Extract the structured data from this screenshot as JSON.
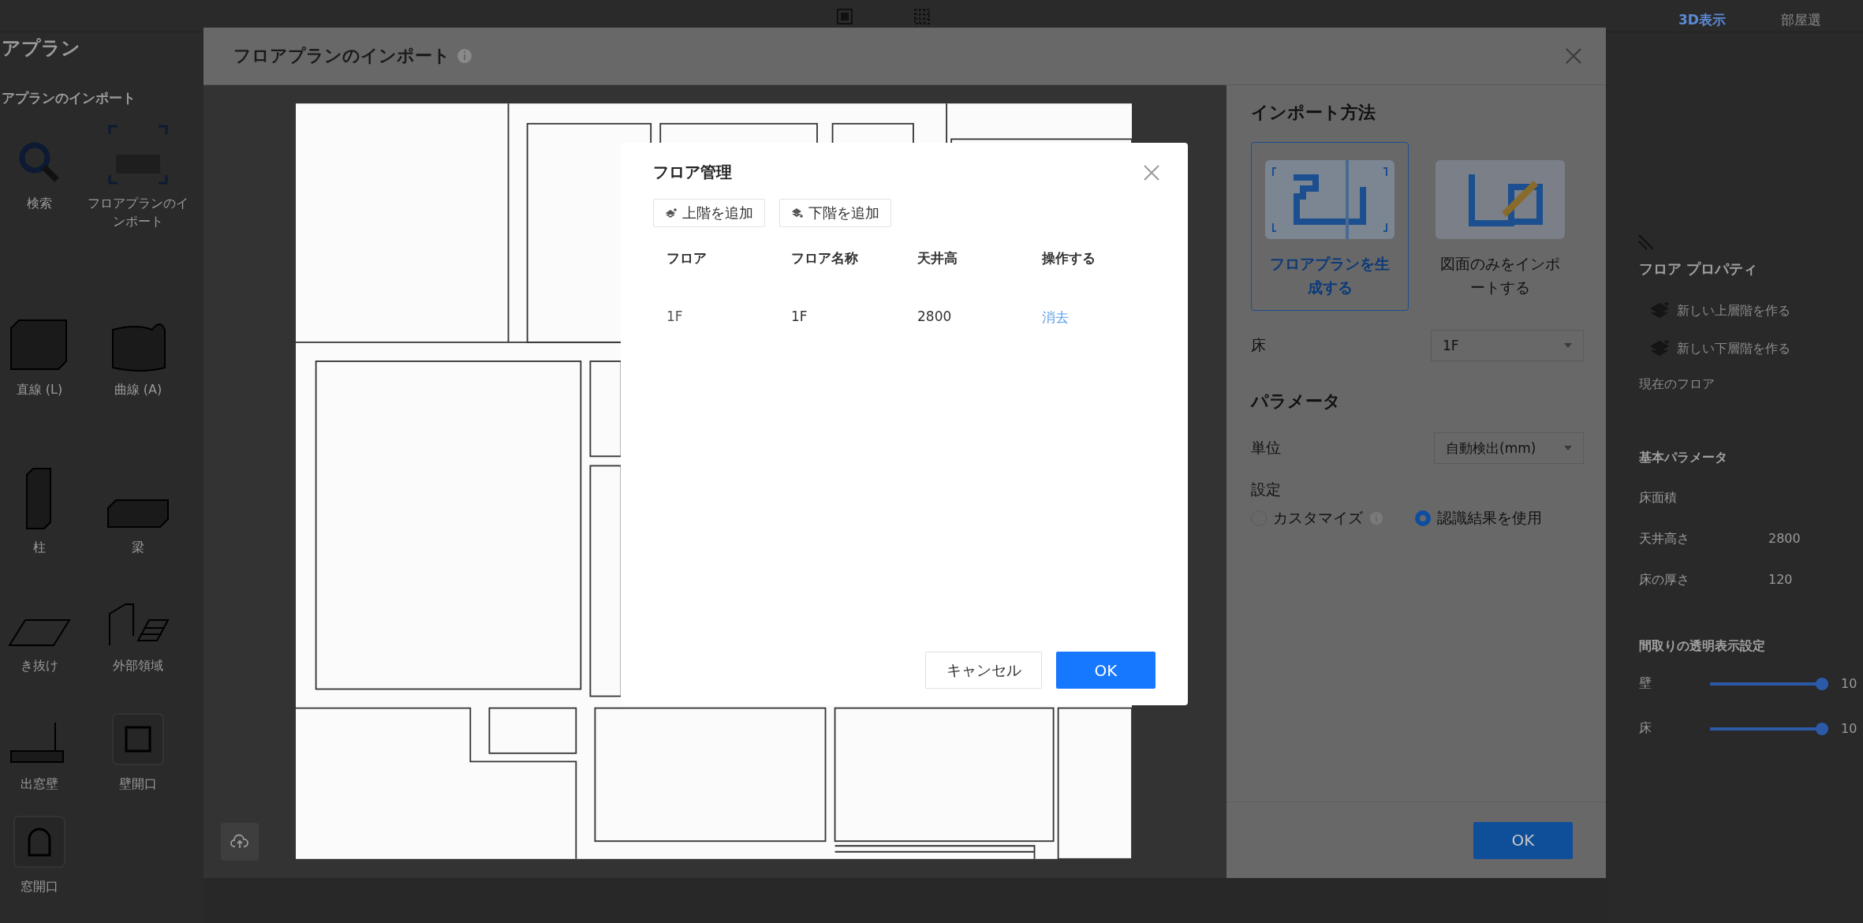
{
  "top_bar": {
    "tabs": [
      {
        "label": "3D表示",
        "selected": true
      },
      {
        "label": "部屋選",
        "selected": false
      }
    ]
  },
  "sidebar": {
    "title": "アプラン",
    "section": "アプランのインポート",
    "tools": [
      {
        "label": "検索"
      },
      {
        "label": "フロアプランのインポート"
      },
      {
        "label": "直線 (L)"
      },
      {
        "label": "曲線 (A)"
      },
      {
        "label": "柱"
      },
      {
        "label": "梁"
      },
      {
        "label": "き抜け"
      },
      {
        "label": "外部領域"
      },
      {
        "label": "出窓壁"
      },
      {
        "label": "壁開口"
      },
      {
        "label": "窓開口"
      }
    ]
  },
  "properties_panel": {
    "title": "フロア プロパティ",
    "actions": [
      "新しい上層階を作る",
      "新しい下層階を作る"
    ],
    "current_floor": "現在のフロア",
    "basic_title": "基本パラメータ",
    "params": [
      {
        "label": "床面積"
      },
      {
        "label": "天井高さ",
        "value": "2800"
      },
      {
        "label": "床の厚さ",
        "value": "120"
      }
    ],
    "transparency_title": "間取りの透明表示設定",
    "sliders": [
      {
        "label": "壁",
        "level": 1,
        "reading": "10"
      },
      {
        "label": "床",
        "level": 1,
        "reading": "10"
      }
    ]
  },
  "import_dialog": {
    "title": "フロアプランのインポート",
    "method_title": "インポート方法",
    "methods": [
      {
        "label": "フロアプランを生成する",
        "selected": true
      },
      {
        "label": "図面のみをインポートする",
        "selected": false
      }
    ],
    "floor": {
      "label": "床",
      "value": "1F"
    },
    "parameters_title": "パラメータ",
    "unit": {
      "label": "単位",
      "value": "自動検出(mm)"
    },
    "setting": {
      "label": "設定",
      "options": [
        {
          "label": "カスタマイズ",
          "selected": false,
          "info": true
        },
        {
          "label": "認識結果を使用",
          "selected": true,
          "info": false
        }
      ]
    },
    "ok_button": "OK"
  },
  "floor_dialog": {
    "title": "フロア管理",
    "buttons": [
      {
        "label": "上階を追加"
      },
      {
        "label": "下階を追加"
      }
    ],
    "columns": [
      "フロア",
      "フロア名称",
      "天井高",
      "操作する"
    ],
    "rows": [
      {
        "cells": [
          "1F",
          "1F",
          "2800"
        ],
        "action": "消去"
      }
    ],
    "cancel_button": "キャンセル",
    "ok_button": "OK"
  }
}
